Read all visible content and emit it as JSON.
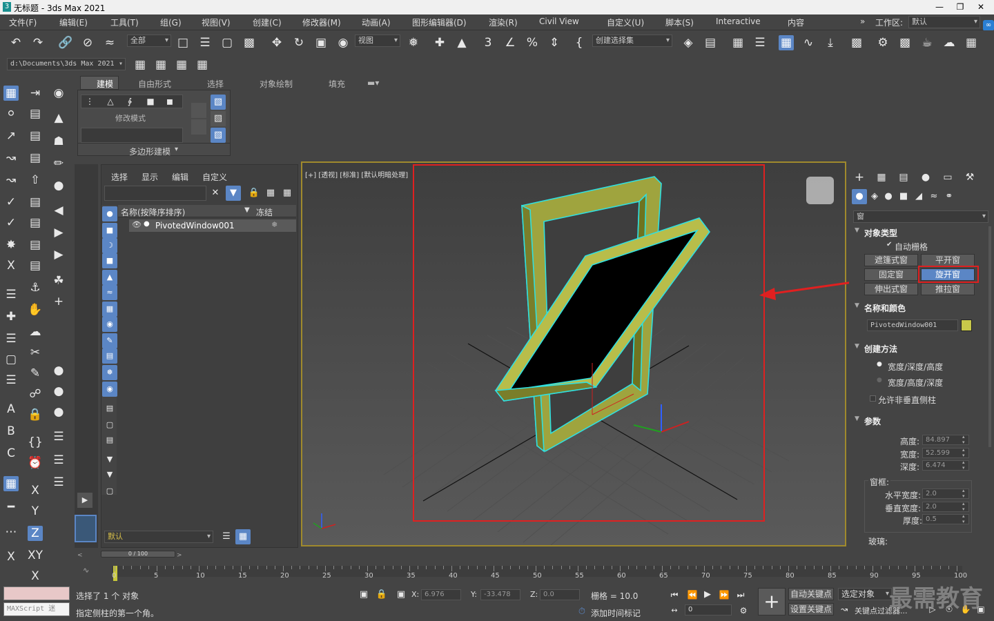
{
  "window": {
    "title": "无标题 - 3ds Max 2021"
  },
  "menus": [
    "文件(F)",
    "编辑(E)",
    "工具(T)",
    "组(G)",
    "视图(V)",
    "创建(C)",
    "修改器(M)",
    "动画(A)",
    "图形编辑器(D)",
    "渲染(R)",
    "Civil View",
    "自定义(U)",
    "脚本(S)",
    "Interactive",
    "内容"
  ],
  "workspace": {
    "label": "工作区:",
    "value": "默认"
  },
  "toolbar": {
    "filter_value": "全部",
    "ref_coord_value": "视图",
    "named_selection_value": "创建选择集",
    "project_path": "d:\\Documents\\3ds Max 2021"
  },
  "ribbon": {
    "tabs": [
      "建模",
      "自由形式",
      "选择",
      "对象绘制",
      "填充"
    ],
    "modify_mode": "修改模式",
    "poly_modeling": "多边形建模"
  },
  "scene_explorer": {
    "tabs": [
      "选择",
      "显示",
      "编辑",
      "自定义"
    ],
    "col_name": "名称(按降序排序)",
    "col_freeze": "冻结",
    "object": "PivotedWindow001",
    "layer": "默认"
  },
  "viewport": {
    "label": "[+] [透视] [标准] [默认明暗处理]"
  },
  "command_panel": {
    "category": "窗",
    "object_type": {
      "header": "对象类型",
      "autogrid": "自动栅格",
      "buttons": [
        "遮篷式窗",
        "平开窗",
        "固定窗",
        "旋开窗",
        "伸出式窗",
        "推拉窗"
      ],
      "selected": "旋开窗"
    },
    "name_color": {
      "header": "名称和颜色",
      "name": "PivotedWindow001",
      "color": "#c8c84a"
    },
    "creation_method": {
      "header": "创建方法",
      "options": [
        "宽度/深度/高度",
        "宽度/高度/深度"
      ],
      "allow": "允许非垂直侧柱"
    },
    "params": {
      "header": "参数",
      "height_label": "高度:",
      "height": "84.897",
      "width_label": "宽度:",
      "width": "52.599",
      "depth_label": "深度:",
      "depth": "6.474",
      "frame": "窗框:",
      "hwidth_label": "水平宽度:",
      "hwidth": "2.0",
      "vwidth_label": "垂直宽度:",
      "vwidth": "2.0",
      "thick_label": "厚度:",
      "thick": "0.5",
      "glass": "玻璃:"
    }
  },
  "timeline": {
    "frame": "0 / 100",
    "ticks": [
      "0",
      "5",
      "10",
      "15",
      "20",
      "25",
      "30",
      "35",
      "40",
      "45",
      "50",
      "55",
      "60",
      "65",
      "70",
      "75",
      "80",
      "85",
      "90",
      "95",
      "100"
    ]
  },
  "status": {
    "maxscript": "MAXScript 迷",
    "selected": "选择了 1 个 对象",
    "prompt": "指定侧柱的第一个角。",
    "x_label": "X:",
    "x": "6.976",
    "y_label": "Y:",
    "y": "-33.478",
    "z_label": "Z:",
    "z": "0.0",
    "grid": "栅格 = 10.0",
    "add_time_tag": "添加时间标记",
    "auto_key": "自动关键点",
    "selected_obj": "选定对象",
    "set_key": "设置关键点",
    "key_filter": "关键点过滤器...",
    "frame_field": "0",
    "watermark": "最需教育"
  },
  "colors": {
    "highlight": "#e02020",
    "accent": "#5b86c5",
    "viewport_border": "#a08a2c"
  }
}
